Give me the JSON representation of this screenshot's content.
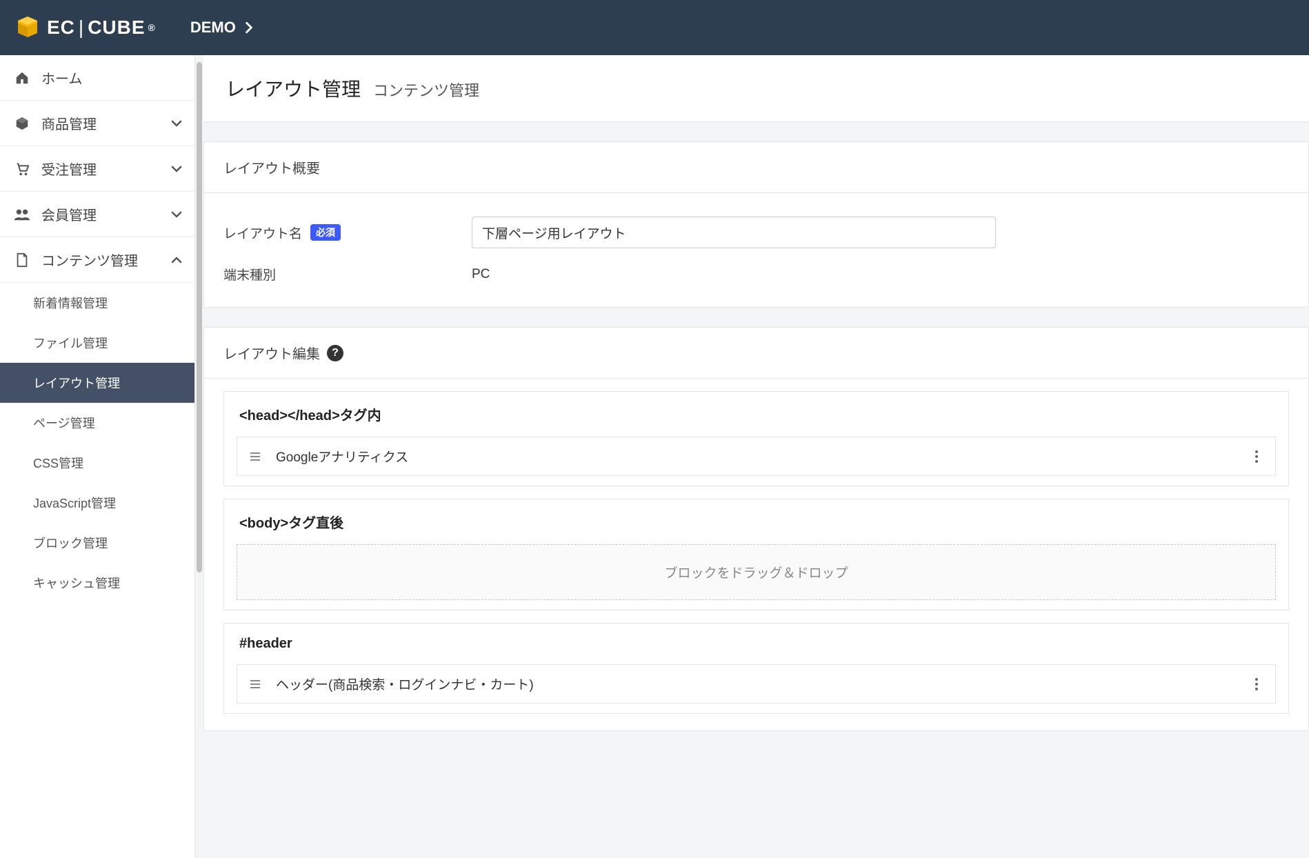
{
  "header": {
    "logo_text_1": "EC",
    "logo_text_2": "CUBE",
    "branch": "DEMO"
  },
  "sidebar": {
    "items": [
      {
        "label": "ホーム",
        "icon": "home",
        "expandable": false
      },
      {
        "label": "商品管理",
        "icon": "cube",
        "expandable": true
      },
      {
        "label": "受注管理",
        "icon": "cart",
        "expandable": true
      },
      {
        "label": "会員管理",
        "icon": "users",
        "expandable": true
      },
      {
        "label": "コンテンツ管理",
        "icon": "file",
        "expandable": true,
        "expanded": true
      }
    ],
    "content_sub": [
      "新着情報管理",
      "ファイル管理",
      "レイアウト管理",
      "ページ管理",
      "CSS管理",
      "JavaScript管理",
      "ブロック管理",
      "キャッシュ管理"
    ],
    "active_sub_index": 2
  },
  "page": {
    "title": "レイアウト管理",
    "breadcrumb": "コンテンツ管理"
  },
  "overview": {
    "header": "レイアウト概要",
    "name_label": "レイアウト名",
    "required_badge": "必須",
    "name_value": "下層ページ用レイアウト",
    "device_label": "端末種別",
    "device_value": "PC"
  },
  "editor": {
    "header": "レイアウト編集",
    "sections": [
      {
        "title": "<head></head>タグ内",
        "blocks": [
          "Googleアナリティクス"
        ],
        "dropzone": false
      },
      {
        "title": "<body>タグ直後",
        "blocks": [],
        "dropzone": true,
        "dropzone_text": "ブロックをドラッグ＆ドロップ"
      },
      {
        "title": "#header",
        "blocks": [
          "ヘッダー(商品検索・ログインナビ・カート)"
        ],
        "dropzone": false
      }
    ]
  }
}
